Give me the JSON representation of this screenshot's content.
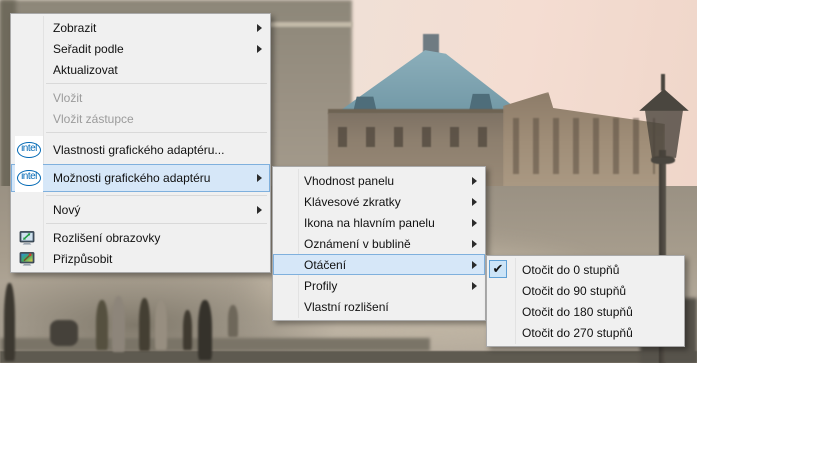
{
  "wallpaper": {
    "description": "old hand-colored postcard photo: street with large building with teal hipped roof, row houses, ornate street lamp on right, pedestrians on pavement, pink-cream sky"
  },
  "colors": {
    "menu_bg": "#f0f0f0",
    "menu_border": "#a9a9a9",
    "highlight_fill": "#d6e7f8",
    "highlight_border": "#7fb0dd",
    "disabled_text": "#9b9b9b",
    "intel_blue": "#0068b5",
    "roof_teal": "#6f96a4",
    "sky_pink": "#f4ddd2"
  },
  "context_menu": {
    "items": [
      {
        "label": "Zobrazit",
        "has_submenu": true
      },
      {
        "label": "Seřadit podle",
        "has_submenu": true
      },
      {
        "label": "Aktualizovat"
      },
      {
        "label": "Vložit",
        "disabled": true
      },
      {
        "label": "Vložit zástupce",
        "disabled": true
      },
      {
        "label": "Vlastnosti grafického adaptéru...",
        "icon": "intel-logo-icon"
      },
      {
        "label": "Možnosti grafického adaptéru",
        "icon": "intel-logo-icon",
        "has_submenu": true,
        "highlighted": true
      },
      {
        "label": "Nový",
        "has_submenu": true
      },
      {
        "label": "Rozlišení obrazovky",
        "icon": "display-resolution-icon"
      },
      {
        "label": "Přizpůsobit",
        "icon": "personalize-icon"
      }
    ],
    "intel_logo_text": "intel"
  },
  "graphics_options_submenu": {
    "items": [
      {
        "label": "Vhodnost panelu",
        "has_submenu": true
      },
      {
        "label": "Klávesové zkratky",
        "has_submenu": true
      },
      {
        "label": "Ikona na hlavním panelu",
        "has_submenu": true
      },
      {
        "label": "Oznámení v bublině",
        "has_submenu": true
      },
      {
        "label": "Otáčení",
        "has_submenu": true,
        "highlighted": true
      },
      {
        "label": "Profily",
        "has_submenu": true
      },
      {
        "label": "Vlastní rozlišení"
      }
    ]
  },
  "rotation_submenu": {
    "checkmark": "✔",
    "items": [
      {
        "label": "Otočit do 0 stupňů",
        "checked": true
      },
      {
        "label": "Otočit do 90 stupňů"
      },
      {
        "label": "Otočit do 180 stupňů"
      },
      {
        "label": "Otočit do 270 stupňů"
      }
    ]
  }
}
